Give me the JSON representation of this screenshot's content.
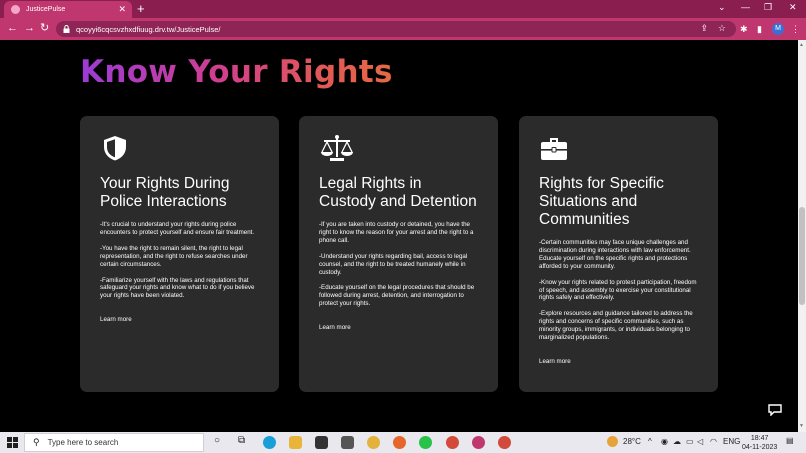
{
  "browser": {
    "tab_title": "JusticePulse",
    "tab_close": "✕",
    "new_tab": "+",
    "url": "qcoyyi6cqcsvzhxdfiuug.drv.tw/JusticePulse/",
    "profile_initial": "M",
    "controls": {
      "minimize": "—",
      "maximize": "❐",
      "close": "✕",
      "dropdown": "⌄"
    }
  },
  "page": {
    "heading": "Know Your Rights",
    "cards": [
      {
        "icon": "shield-icon",
        "title": "Your Rights During Police Interactions",
        "paragraphs": [
          "-It's crucial to understand your rights during police encounters to protect yourself and ensure fair treatment.",
          "-You have the right to remain silent, the right to legal representation, and the right to refuse searches under certain circumstances.",
          "-Familiarize yourself with the laws and regulations that safeguard your rights and know what to do if you believe your rights have been violated."
        ],
        "link": "Learn more"
      },
      {
        "icon": "scales-icon",
        "title": "Legal Rights in Custody and Detention",
        "paragraphs": [
          "-If you are taken into custody or detained, you have the right to know the reason for your arrest and the right to a phone call.",
          "-Understand your rights regarding bail, access to legal counsel, and the right to be treated humanely while in custody.",
          "-Educate yourself on the legal procedures that should be followed during arrest, detention, and interrogation to protect your rights."
        ],
        "link": "Learn more"
      },
      {
        "icon": "briefcase-icon",
        "title": "Rights for Specific Situations and Communities",
        "paragraphs": [
          "-Certain communities may face unique challenges and discrimination during interactions with law enforcement. Educate yourself on the specific rights and protections afforded to your community.",
          "-Know your rights related to protest participation, freedom of speech, and assembly to exercise your constitutional rights safely and effectively.",
          "-Explore resources and guidance tailored to address the rights and concerns of specific communities, such as minority groups, immigrants, or individuals belonging to marginalized populations."
        ],
        "link": "Learn more"
      }
    ]
  },
  "taskbar": {
    "search_placeholder": "Type here to search",
    "weather": "28°C",
    "language": "ENG",
    "time": "18:47",
    "date": "04-11-2023"
  },
  "colors": {
    "tab_bar": "#8a1e4e",
    "address_bar": "#c0376f",
    "card_bg": "#2b2b2b",
    "heading_gradient": [
      "#9b3bd6",
      "#d13f8e",
      "#e56a45"
    ]
  }
}
